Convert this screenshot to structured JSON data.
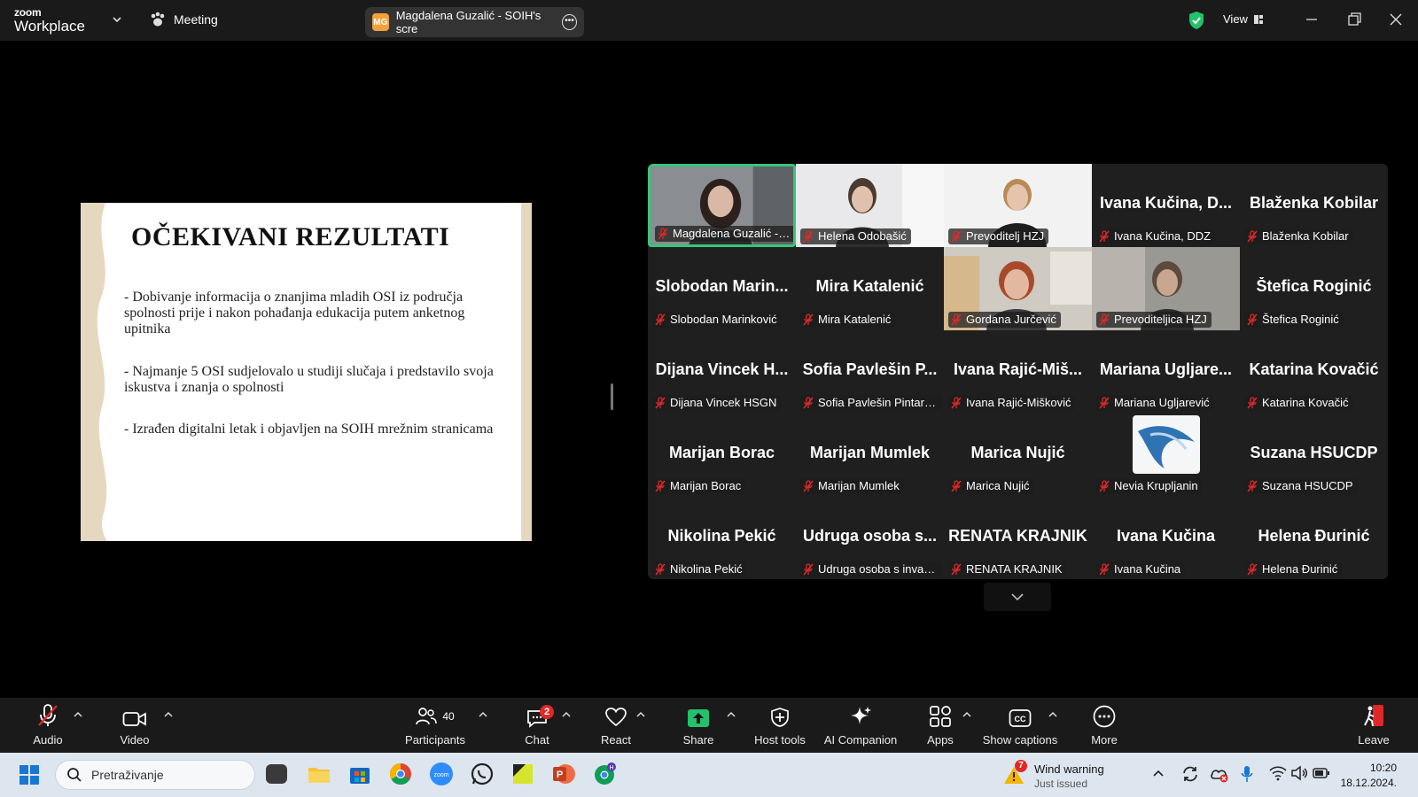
{
  "titlebar": {
    "logo_top": "zoom",
    "logo_bottom": "Workplace",
    "meeting_label": "Meeting",
    "share_pill_initials": "MG",
    "share_pill_text": "Magdalena Guzalić - SOIH's scre",
    "view_label": "View"
  },
  "slide": {
    "title": "OČEKIVANI REZULTATI",
    "bullets": [
      "- Dobivanje informacija o znanjima mladih OSI iz područja spolnosti prije i nakon pohađanja edukacija putem anketnog upitnika",
      "- Najmanje 5 OSI sudjelovalo u studiji slučaja i predstavilo svoja iskustva i znanja o spolnosti",
      "- Izrađen digitalni letak i objavljen na SOIH mrežnim stranicama"
    ]
  },
  "gallery": {
    "tiles": [
      {
        "big": "",
        "name": "Magdalena Guzalić - SOIH",
        "video": true
      },
      {
        "big": "",
        "name": "Helena Odobašić",
        "video": true
      },
      {
        "big": "",
        "name": "Prevoditelj HZJ",
        "video": true
      },
      {
        "big": "Ivana Kučina, D...",
        "name": "Ivana Kučina, DDZ",
        "video": false
      },
      {
        "big": "Blaženka Kobilar",
        "name": "Blaženka Kobilar",
        "video": false
      },
      {
        "big": "Slobodan Marin...",
        "name": "Slobodan Marinković",
        "video": false
      },
      {
        "big": "Mira Katalenić",
        "name": "Mira Katalenić",
        "video": false
      },
      {
        "big": "",
        "name": "Gordana Jurčević",
        "video": true
      },
      {
        "big": "",
        "name": "Prevoditeljica HZJ",
        "video": true
      },
      {
        "big": "Štefica Roginić",
        "name": "Štefica Roginić",
        "video": false
      },
      {
        "big": "Dijana Vincek H...",
        "name": "Dijana Vincek HSGN",
        "video": false
      },
      {
        "big": "Sofia Pavlešin P...",
        "name": "Sofia Pavlešin Pintarić ...",
        "video": false
      },
      {
        "big": "Ivana Rajić-Miš...",
        "name": "Ivana Rajić-Mišković",
        "video": false
      },
      {
        "big": "Mariana Ugljare...",
        "name": "Mariana Ugljarević",
        "video": false
      },
      {
        "big": "Katarina Kovačić",
        "name": "Katarina Kovačić",
        "video": false
      },
      {
        "big": "Marijan Borac",
        "name": "Marijan Borac",
        "video": false
      },
      {
        "big": "Marijan Mumlek",
        "name": "Marijan Mumlek",
        "video": false
      },
      {
        "big": "Marica Nujić",
        "name": "Marica Nujić",
        "video": false
      },
      {
        "big": "",
        "name": "Nevia Krupljanin",
        "video": false
      },
      {
        "big": "Suzana HSUCDP",
        "name": "Suzana HSUCDP",
        "video": false
      },
      {
        "big": "Nikolina Pekić",
        "name": "Nikolina Pekić",
        "video": false
      },
      {
        "big": "Udruga osoba s...",
        "name": "Udruga osoba s invalid...",
        "video": false
      },
      {
        "big": "RENATA KRAJNIK",
        "name": "RENATA KRAJNIK",
        "video": false
      },
      {
        "big": "Ivana Kučina",
        "name": "Ivana Kučina",
        "video": false
      },
      {
        "big": "Helena Đurinić",
        "name": "Helena Đurinić",
        "video": false
      }
    ]
  },
  "toolbar": {
    "audio": "Audio",
    "video": "Video",
    "participants": "Participants",
    "participants_count": "40",
    "chat": "Chat",
    "chat_badge": "2",
    "react": "React",
    "share": "Share",
    "host_tools": "Host tools",
    "ai_companion": "AI Companion",
    "apps": "Apps",
    "captions": "Show captions",
    "more": "More",
    "leave": "Leave"
  },
  "taskbar": {
    "search_placeholder": "Pretraživanje",
    "weather_title": "Wind warning",
    "weather_sub": "Just issued",
    "weather_badge": "7",
    "time": "10:20",
    "date": "18.12.2024."
  },
  "colors": {
    "active_speaker": "#34c77b",
    "share_green": "#23c16b",
    "leave_red": "#e02828",
    "badge_red": "#e02828"
  }
}
